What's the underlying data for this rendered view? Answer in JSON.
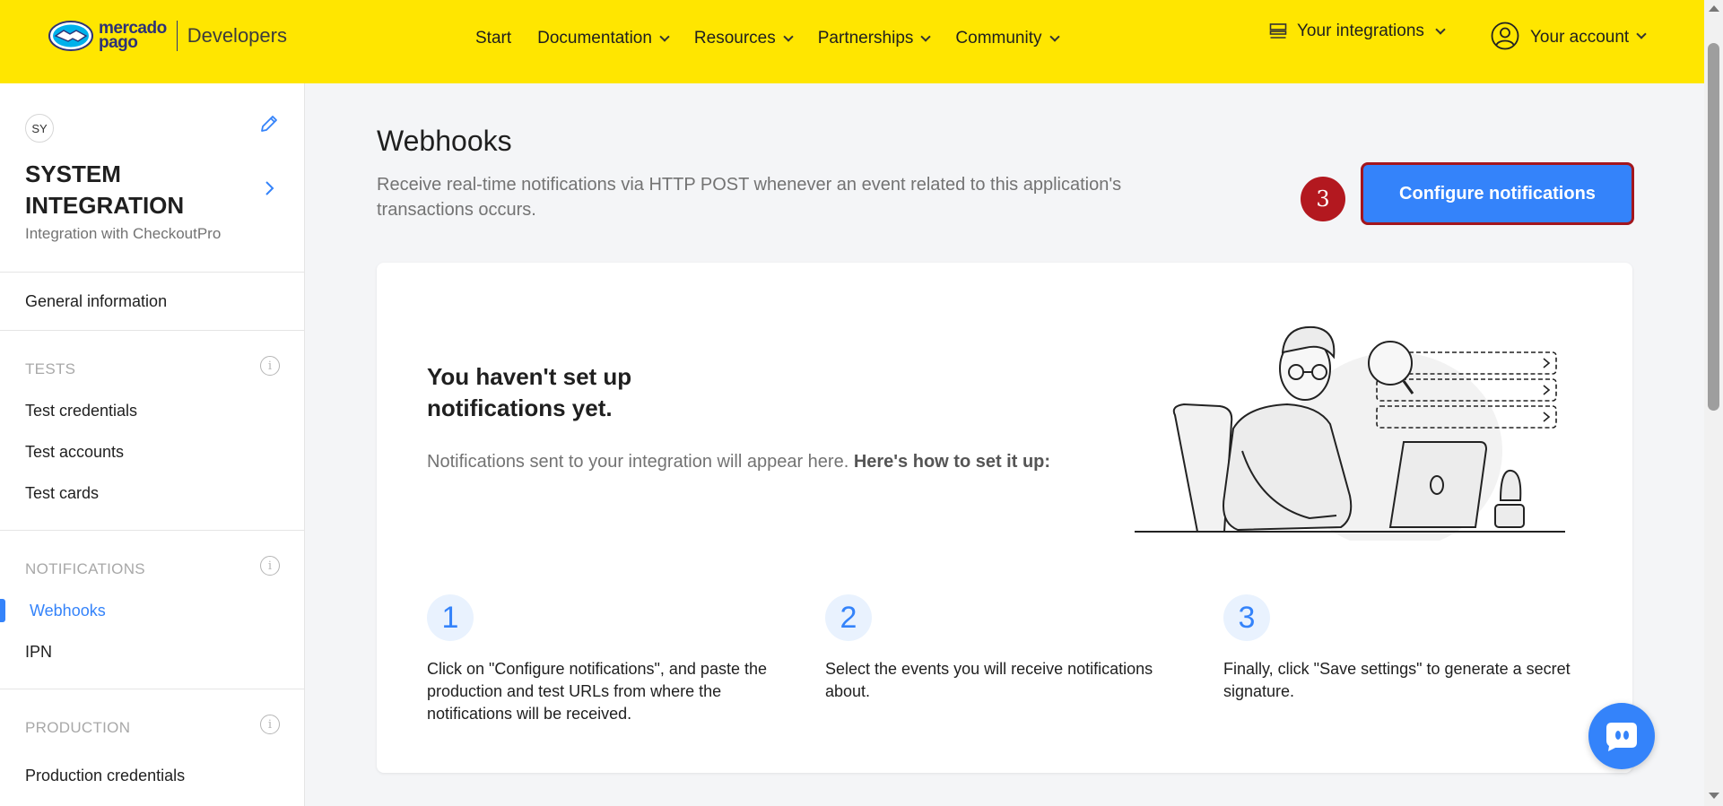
{
  "header": {
    "logo_text_line1": "mercado",
    "logo_text_line2": "pago",
    "developers": "Developers",
    "nav": [
      {
        "label": "Start",
        "has_dropdown": false
      },
      {
        "label": "Documentation",
        "has_dropdown": true
      },
      {
        "label": "Resources",
        "has_dropdown": true
      },
      {
        "label": "Partnerships",
        "has_dropdown": true
      },
      {
        "label": "Community",
        "has_dropdown": true
      }
    ],
    "integrations": "Your integrations",
    "account": "Your account",
    "bg_color": "#ffe600"
  },
  "sidebar": {
    "avatar": "SY",
    "app_name": "SYSTEM INTEGRATION",
    "app_desc": "Integration with CheckoutPro",
    "general": "General information",
    "tests_label": "TESTS",
    "tests": [
      "Test credentials",
      "Test accounts",
      "Test cards"
    ],
    "notifications_label": "NOTIFICATIONS",
    "notifications": [
      "Webhooks",
      "IPN"
    ],
    "active_item": "Webhooks",
    "production_label": "PRODUCTION",
    "production": [
      "Production credentials"
    ]
  },
  "main": {
    "title": "Webhooks",
    "description": "Receive real-time notifications via HTTP POST whenever an event related to this application's transactions occurs.",
    "step_badge": "3",
    "configure_button": "Configure notifications",
    "empty_title": "You haven't set up notifications yet.",
    "empty_desc": "Notifications sent to your integration will appear here.",
    "empty_desc_bold": "Here's how to set it up:",
    "steps": [
      {
        "num": "1",
        "text": "Click on \"Configure notifications\", and paste the production and test URLs from where the notifications will be received."
      },
      {
        "num": "2",
        "text": "Select the events you will receive notifications about."
      },
      {
        "num": "3",
        "text": "Finally, click \"Save settings\" to generate a secret signature."
      }
    ]
  },
  "colors": {
    "accent": "#3483fa",
    "badge_red": "#b3181f",
    "brand_yellow": "#ffe600"
  }
}
